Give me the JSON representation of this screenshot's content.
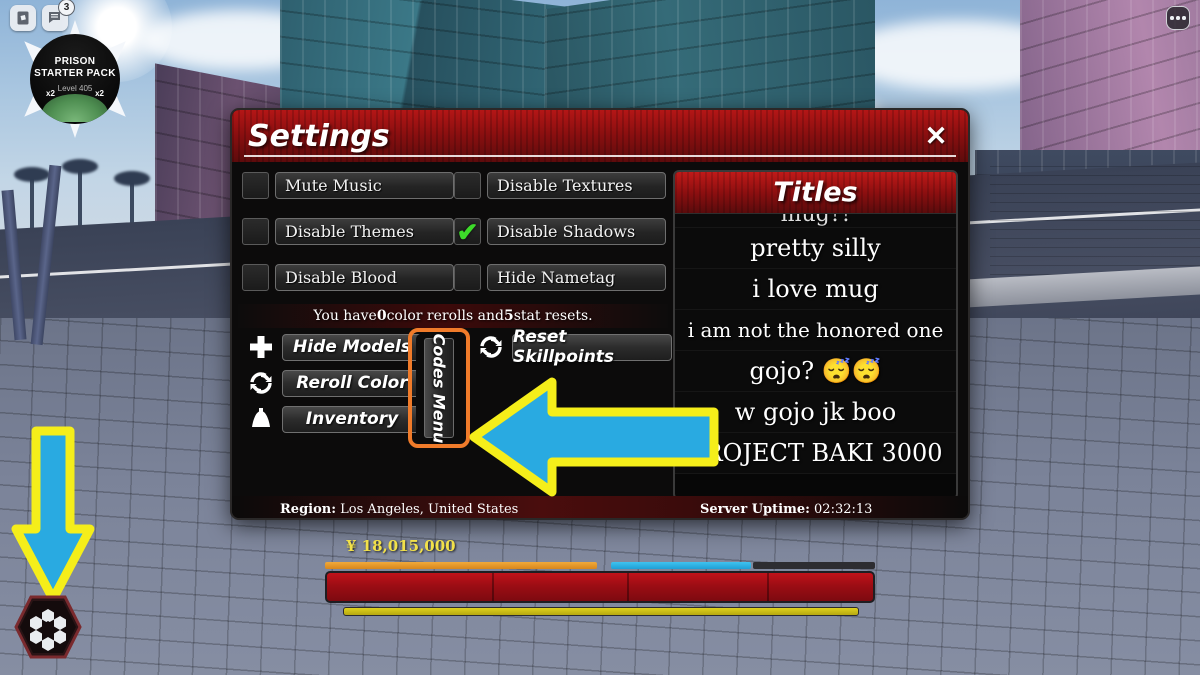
{
  "hud": {
    "roblox_icon": "roblox-logo-icon",
    "chat_icon": "chat-icon",
    "chat_badge": "3",
    "menu_dots": "ellipsis-icon",
    "starter_pack": {
      "line1": "PRISON",
      "line2": "STARTER PACK",
      "level": "Level 405",
      "mult_left": "x2",
      "mult_right": "x2"
    },
    "money": "¥ 18,015,000"
  },
  "settings": {
    "title": "Settings",
    "close_label": "✕",
    "checkboxes": [
      {
        "label": "Mute Music",
        "checked": false
      },
      {
        "label": "Disable Textures",
        "checked": false
      },
      {
        "label": "Disable Themes",
        "checked": false
      },
      {
        "label": "Disable Shadows",
        "checked": true
      },
      {
        "label": "Disable Blood",
        "checked": false
      },
      {
        "label": "Hide Nametag",
        "checked": false
      }
    ],
    "check_glyph": "✔",
    "reroll_banner": {
      "prefix": "You have ",
      "rerolls": "0",
      "middle": " color rerolls and ",
      "resets": "5",
      "suffix": " stat resets."
    },
    "actions_left": [
      {
        "label": "Hide Models",
        "icon": "plus-cross-icon"
      },
      {
        "label": "Reroll Color",
        "icon": "refresh-icon"
      },
      {
        "label": "Inventory",
        "icon": "bag-icon"
      }
    ],
    "actions_right": [
      {
        "label": "Reset Skillpoints",
        "icon": "refresh-icon"
      }
    ],
    "codes_menu_label": "Codes Menu",
    "footer": {
      "region_label": "Region:",
      "region_value": " Los Angeles, United States",
      "uptime_label": "Server Uptime:",
      "uptime_value": " 02:32:13"
    }
  },
  "titles_panel": {
    "header": "Titles",
    "partial_top": "mug?!",
    "items": [
      {
        "text": "pretty silly",
        "size": "normal"
      },
      {
        "text": "i love mug",
        "size": "normal"
      },
      {
        "text": "i am not the honored one",
        "size": "small"
      },
      {
        "text": "gojo? 😴😴",
        "size": "normal"
      },
      {
        "text": "w gojo jk boo",
        "size": "normal"
      },
      {
        "text": "PROJECT BAKI 3000",
        "size": "normal"
      }
    ]
  },
  "annotations": {
    "arrow_left_name": "highlight-arrow-pointing-at-codes-menu",
    "arrow_down_name": "highlight-arrow-pointing-at-settings-button",
    "highlight_box_name": "codes-menu-highlight-box"
  },
  "colors": {
    "accent_red": "#b41616",
    "highlight_orange": "#f07b2a",
    "arrow_fill": "#29aae1",
    "arrow_stroke": "#f5ee1a",
    "check_green": "#3ddb2a",
    "money_yellow": "#f2e14a"
  }
}
